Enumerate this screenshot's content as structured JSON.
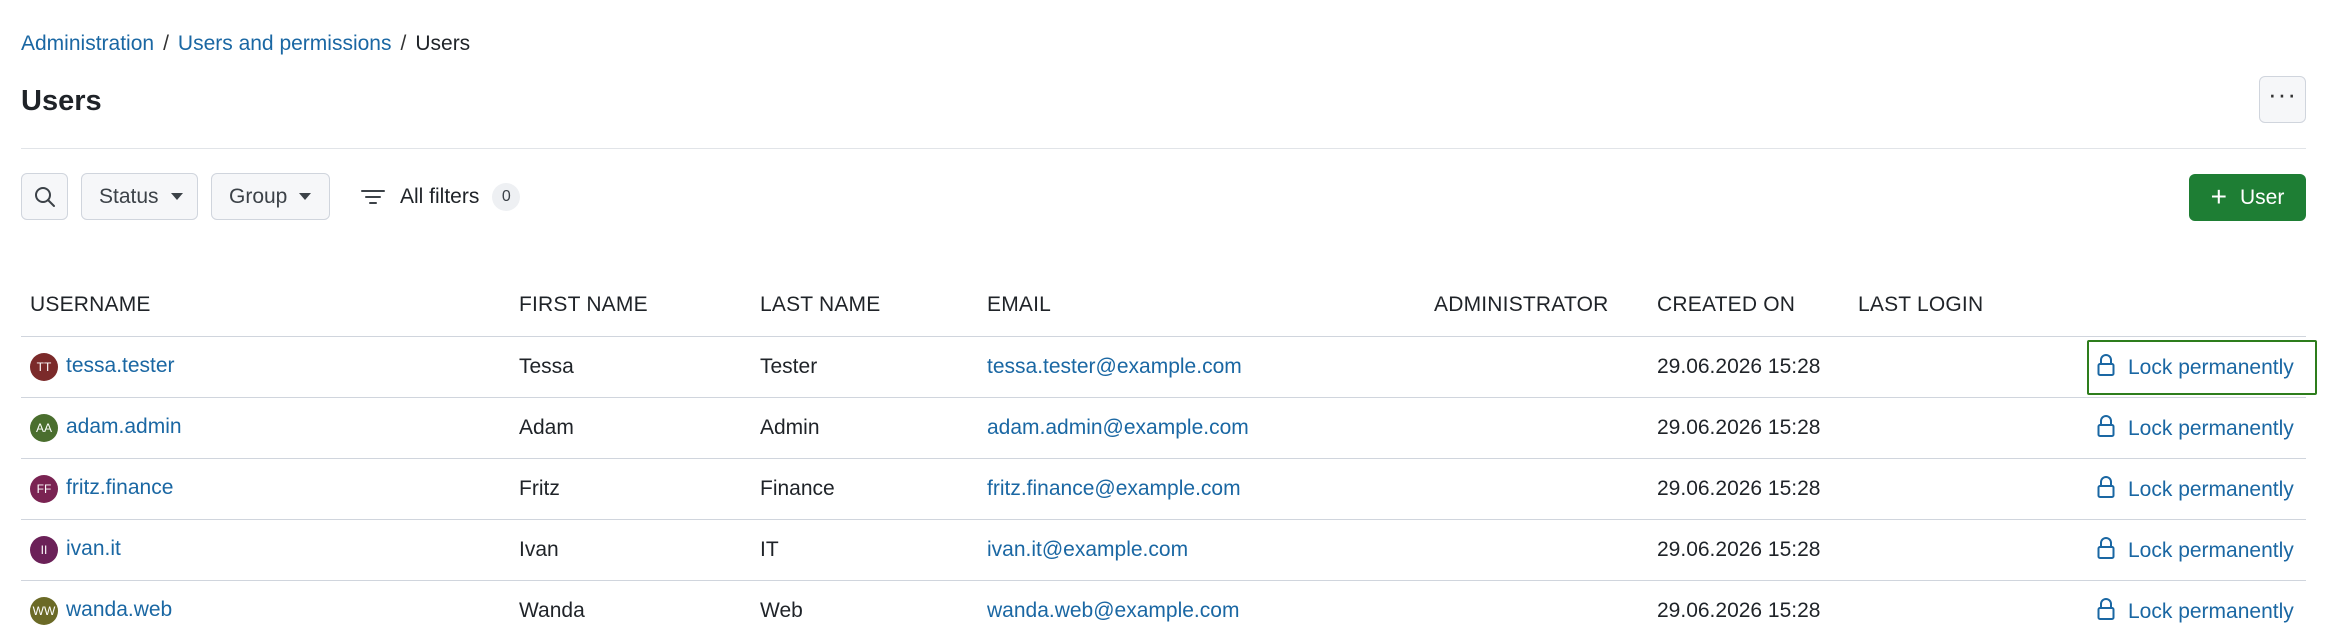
{
  "breadcrumb": {
    "items": [
      "Administration",
      "Users and permissions"
    ],
    "separator": "/",
    "current": "Users"
  },
  "page": {
    "title": "Users",
    "more_icon": "more-horizontal-icon"
  },
  "toolbar": {
    "search_icon": "search-icon",
    "status_label": "Status",
    "group_label": "Group",
    "all_filters_label": "All filters",
    "all_filters_count": "0",
    "add_user_label": "User",
    "add_user_icon": "plus-icon"
  },
  "table": {
    "columns": {
      "username": "USERNAME",
      "first_name": "FIRST NAME",
      "last_name": "LAST NAME",
      "email": "EMAIL",
      "administrator": "ADMINISTRATOR",
      "created_on": "CREATED ON",
      "last_login": "LAST LOGIN"
    },
    "rows": [
      {
        "initials": "TT",
        "avatar_color": "#7b2a2a",
        "username": "tessa.tester",
        "first_name": "Tessa",
        "last_name": "Tester",
        "email": "tessa.tester@example.com",
        "administrator": "",
        "created_on": "29.06.2026 15:28",
        "last_login": "",
        "action": "Lock permanently"
      },
      {
        "initials": "AA",
        "avatar_color": "#4a6e2e",
        "username": "adam.admin",
        "first_name": "Adam",
        "last_name": "Admin",
        "email": "adam.admin@example.com",
        "administrator": "",
        "created_on": "29.06.2026 15:28",
        "last_login": "",
        "action": "Lock permanently"
      },
      {
        "initials": "FF",
        "avatar_color": "#7a2352",
        "username": "fritz.finance",
        "first_name": "Fritz",
        "last_name": "Finance",
        "email": "fritz.finance@example.com",
        "administrator": "",
        "created_on": "29.06.2026 15:28",
        "last_login": "",
        "action": "Lock permanently"
      },
      {
        "initials": "II",
        "avatar_color": "#6b2158",
        "username": "ivan.it",
        "first_name": "Ivan",
        "last_name": "IT",
        "email": "ivan.it@example.com",
        "administrator": "",
        "created_on": "29.06.2026 15:28",
        "last_login": "",
        "action": "Lock permanently"
      },
      {
        "initials": "WW",
        "avatar_color": "#6b6a26",
        "username": "wanda.web",
        "first_name": "Wanda",
        "last_name": "Web",
        "email": "wanda.web@example.com",
        "administrator": "",
        "created_on": "29.06.2026 15:28",
        "last_login": "",
        "action": "Lock permanently"
      }
    ]
  },
  "colors": {
    "link": "#1a67a3",
    "primary_button": "#1e7e34",
    "focus_outline": "#2d7d1c"
  }
}
